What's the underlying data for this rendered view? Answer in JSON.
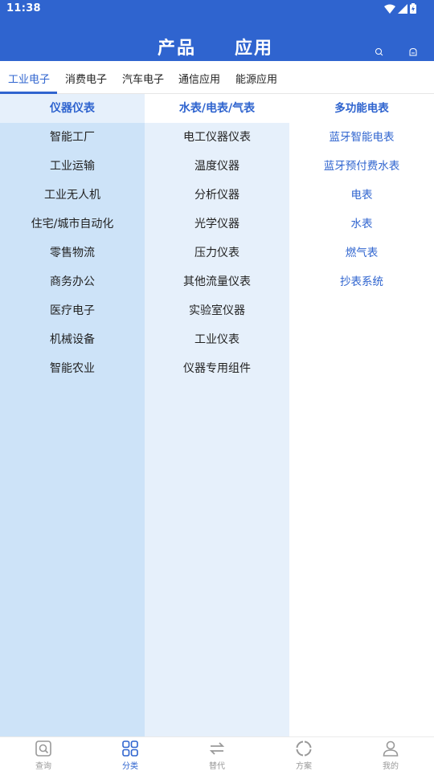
{
  "status": {
    "time": "11:38"
  },
  "header": {
    "tabs": [
      "产品",
      "应用"
    ]
  },
  "category_tabs": [
    "工业电子",
    "消费电子",
    "汽车电子",
    "通信应用",
    "能源应用"
  ],
  "active_category": 0,
  "column1": {
    "items": [
      "仪器仪表",
      "智能工厂",
      "工业运输",
      "工业无人机",
      "住宅/城市自动化",
      "零售物流",
      "商务办公",
      "医疗电子",
      "机械设备",
      "智能农业"
    ],
    "selected": 0
  },
  "column2": {
    "items": [
      "水表/电表/气表",
      "电工仪器仪表",
      "温度仪器",
      "分析仪器",
      "光学仪器",
      "压力仪表",
      "其他流量仪表",
      "实验室仪器",
      "工业仪表",
      "仪器专用组件"
    ],
    "selected": 0
  },
  "column3": {
    "items": [
      "多功能电表",
      "蓝牙智能电表",
      "蓝牙预付费水表",
      "电表",
      "水表",
      "燃气表",
      "抄表系统"
    ]
  },
  "bottom_nav": {
    "items": [
      {
        "label": "查询",
        "icon": "search-box-icon"
      },
      {
        "label": "分类",
        "icon": "grid-icon"
      },
      {
        "label": "替代",
        "icon": "swap-arrows-icon"
      },
      {
        "label": "方案",
        "icon": "loading-ring-icon"
      },
      {
        "label": "我的",
        "icon": "person-icon"
      }
    ],
    "active": 1
  },
  "colors": {
    "brand": "#2f64cf",
    "column1_bg": "#cde3f8",
    "column2_bg": "#e6f0fb",
    "column3_bg": "#ffffff"
  }
}
